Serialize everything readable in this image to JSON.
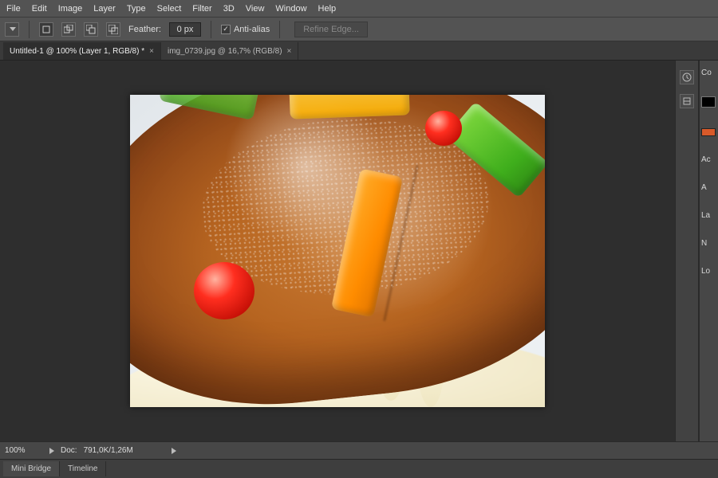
{
  "menu": {
    "items": [
      "File",
      "Edit",
      "Image",
      "Layer",
      "Type",
      "Select",
      "Filter",
      "3D",
      "View",
      "Window",
      "Help"
    ]
  },
  "options": {
    "feather_label": "Feather:",
    "feather_value": "0 px",
    "antialias_label": "Anti-alias",
    "antialias_checked": "✓",
    "refine_label": "Refine Edge..."
  },
  "tabs": [
    {
      "label": "Untitled-1 @ 100% (Layer 1, RGB/8) *",
      "active": true
    },
    {
      "label": "img_0739.jpg @ 16,7% (RGB/8)",
      "active": false
    }
  ],
  "tab_close": "×",
  "right_panels": {
    "group1": "Co",
    "group2": "Ac",
    "group2b": "A",
    "group3": "La",
    "group3b": "N",
    "group3c": "Lo"
  },
  "status": {
    "zoom": "100%",
    "doc_label": "Doc:",
    "doc_value": "791,0K/1,26M"
  },
  "bottom_tabs": {
    "a": "Mini Bridge",
    "b": "Timeline"
  },
  "canvas": {
    "subject": "Roscón de Reyes bread with candied fruit, sugar and cream filling on white plate"
  }
}
